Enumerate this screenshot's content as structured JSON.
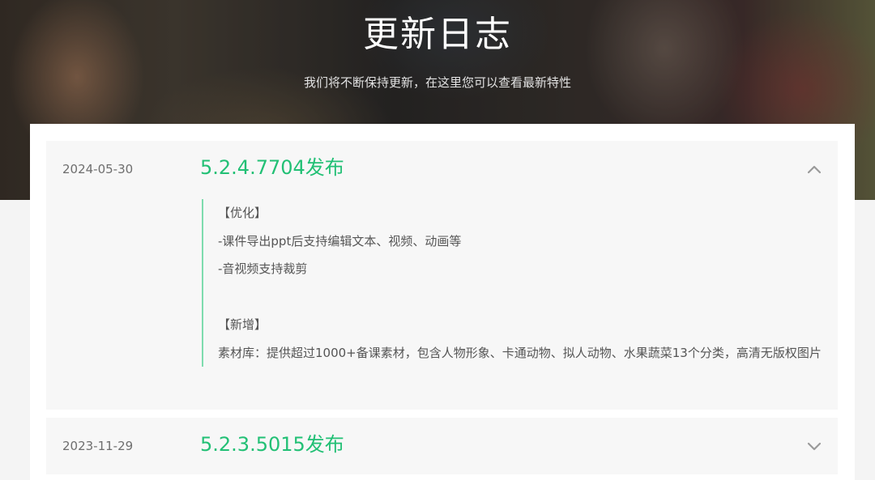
{
  "header": {
    "title": "更新日志",
    "subtitle": "我们将不断保持更新，在这里您可以查看最新特性"
  },
  "releases": [
    {
      "date": "2024-05-30",
      "title": "5.2.4.7704发布",
      "expanded": true,
      "toggle_icon": "chevron-up-icon",
      "lines": [
        "【优化】",
        "-课件导出ppt后支持编辑文本、视频、动画等",
        "-音视频支持裁剪",
        "",
        "【新增】",
        "素材库：提供超过1000+备课素材，包含人物形象、卡通动物、拟人动物、水果蔬菜13个分类，高清无版权图片"
      ]
    },
    {
      "date": "2023-11-29",
      "title": "5.2.3.5015发布",
      "expanded": false,
      "toggle_icon": "chevron-down-icon"
    }
  ],
  "colors": {
    "accent": "#22c075",
    "accent_line": "#7fdcae",
    "text": "#555555",
    "date": "#6e6e6e",
    "card_bg": "#f7f7f7"
  }
}
